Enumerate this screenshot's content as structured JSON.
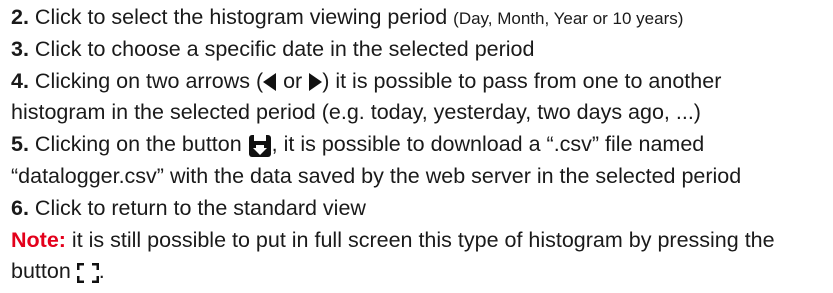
{
  "items": [
    {
      "num": "2.",
      "text": " Click to select the histogram viewing period ",
      "small": "(Day, Month, Year or 10 years)"
    },
    {
      "num": "3.",
      "text": " Click to choose a specific date in the selected period"
    },
    {
      "num": "4.",
      "text_a": " Clicking on two arrows (",
      "text_b": " or ",
      "text_c": ") it is possible to pass from one to another",
      "line2": "histogram in the selected period (e.g. today, yesterday, two days ago, ...)"
    },
    {
      "num": "5.",
      "text_a": " Clicking on the button ",
      "text_b": ", it is possible to download a “.csv” file named",
      "line2": "“datalogger.csv” with the data saved by the web server in the selected period"
    },
    {
      "num": "6.",
      "text": " Click to return to the standard view"
    }
  ],
  "note": {
    "label": "Note:",
    "text": " it is still possible to put in full screen this type of histogram by pressing the",
    "line2_a": "button ",
    "line2_b": "."
  },
  "icons": {
    "arrow_left": "left-triangle-arrow-icon",
    "arrow_right": "right-triangle-arrow-icon",
    "download": "download-save-icon",
    "fullscreen": "fullscreen-corners-icon"
  },
  "colors": {
    "text": "#1a1a1a",
    "note_label": "#e3001b"
  }
}
